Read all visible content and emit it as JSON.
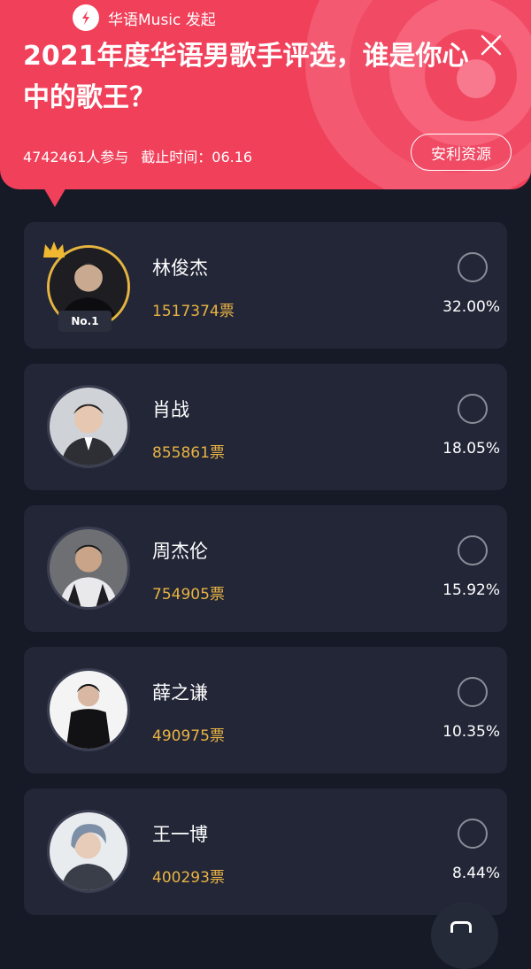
{
  "header": {
    "source_label": "华语Music 发起",
    "title": "2021年度华语男歌手评选，谁是你心中的歌王？",
    "participants": "4742461人参与",
    "deadline": "截止时间：06.16",
    "resource_button": "安利资源",
    "colors": {
      "background": "#f0405a",
      "text": "#ffffff"
    }
  },
  "candidates": [
    {
      "name": "林俊杰",
      "votes": "1517374票",
      "percent": "32.00%",
      "rank_badge": "No.1"
    },
    {
      "name": "肖战",
      "votes": "855861票",
      "percent": "18.05%"
    },
    {
      "name": "周杰伦",
      "votes": "754905票",
      "percent": "15.92%"
    },
    {
      "name": "薛之谦",
      "votes": "490975票",
      "percent": "10.35%"
    },
    {
      "name": "王一博",
      "votes": "400293票",
      "percent": "8.44%"
    }
  ],
  "colors": {
    "page_bg": "#161a27",
    "card_bg": "#222637",
    "votes": "#e9b343",
    "crown": "#f0b830"
  }
}
